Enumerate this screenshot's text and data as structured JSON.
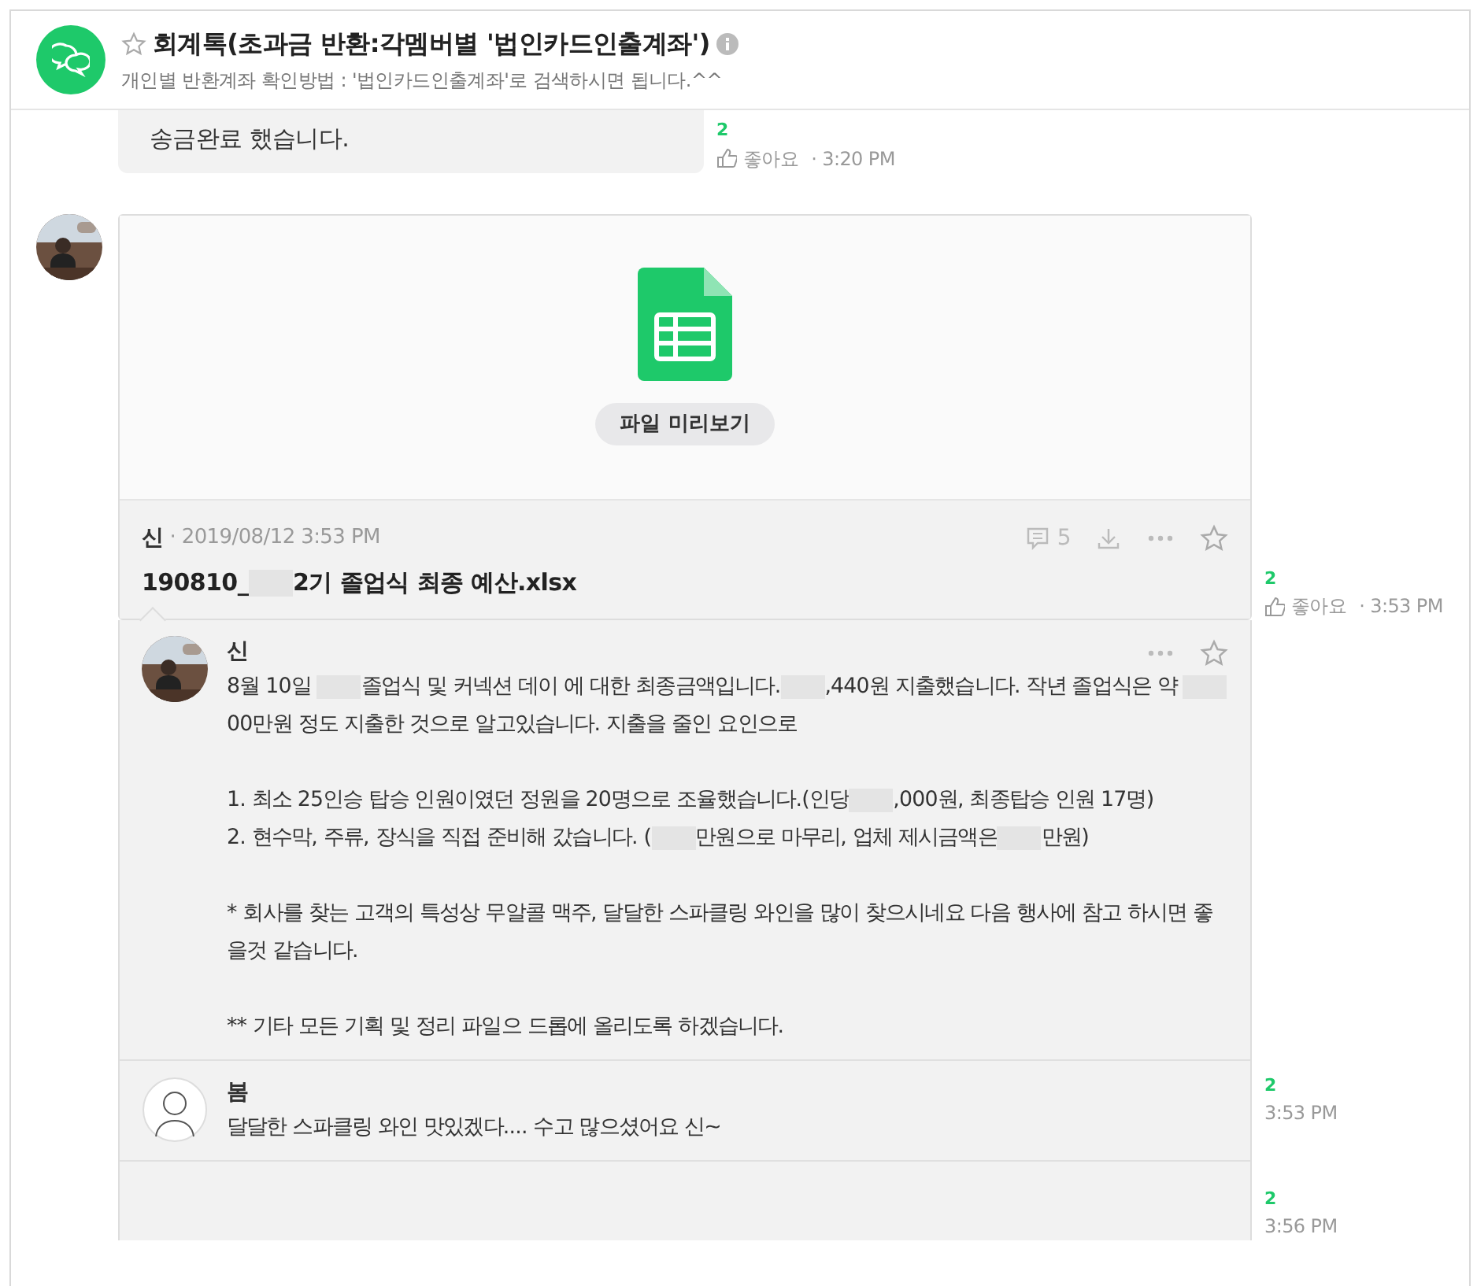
{
  "header": {
    "title": "회계톡(초과금 반환:각멤버별 '법인카드인출계좌')",
    "subtitle": "개인별 반환계좌 확인방법 : '법인카드인출계좌'로 검색하시면 됩니다.^^",
    "starred": false
  },
  "messages": [
    {
      "kind": "text",
      "text": "송금완료 했습니다.",
      "unread": "2",
      "like": "좋아요",
      "time": "· 3:20 PM"
    },
    {
      "kind": "file",
      "preview_button": "파일 미리보기",
      "author": "신",
      "date": "· 2019/08/12 3:53 PM",
      "comment_count": "5",
      "filename_parts": [
        "190810_",
        {
          "kind": "redacted"
        },
        "2기 졸업식 최종 예산.xlsx"
      ],
      "starred": false,
      "unread": "2",
      "like": "좋아요",
      "time": "· 3:53 PM"
    }
  ],
  "comments": [
    {
      "author": "신",
      "starred": false,
      "paragraphs": [
        [
          "8월 10일 ",
          {
            "kind": "redacted"
          },
          "졸업식 및 커넥션 데이 에 대한 최종금액입니다.",
          {
            "kind": "redacted"
          },
          ",440원 지출했습니다. 작년 졸업식은 약 ",
          {
            "kind": "redacted"
          },
          "00만원 정도 지출한 것으로 알고있습니다. 지출을 줄인 요인으로"
        ],
        [
          "1. 최소 25인승 탑승 인원이였던 정원을 20명으로 조율했습니다.(인당",
          {
            "kind": "redacted"
          },
          ",000원, 최종탑승 인원 17명)"
        ],
        [
          "2. 현수막, 주류, 장식을 직접 준비해 갔습니다. (",
          {
            "kind": "redacted"
          },
          "만원으로 마무리, 업체 제시금액은",
          {
            "kind": "redacted"
          },
          "만원)"
        ],
        [
          "* 회사를 찾는 고객의 특성상 무알콜 맥주, 달달한 스파클링 와인을 많이 찾으시네요 다음 행사에 참고 하시면 좋을것 같습니다."
        ],
        [
          "** 기타 모든 기획 및 정리 파일으 드롭에 올리도록 하겠습니다."
        ]
      ],
      "unread": "2",
      "time": "3:53 PM"
    },
    {
      "author": "봄",
      "kind": "drawing",
      "paragraphs": [
        [
          "달달한 스파클링 와인 맛있겠다.... 수고 많으셨어요 신~"
        ]
      ],
      "unread": "2",
      "time": "3:56 PM"
    }
  ]
}
